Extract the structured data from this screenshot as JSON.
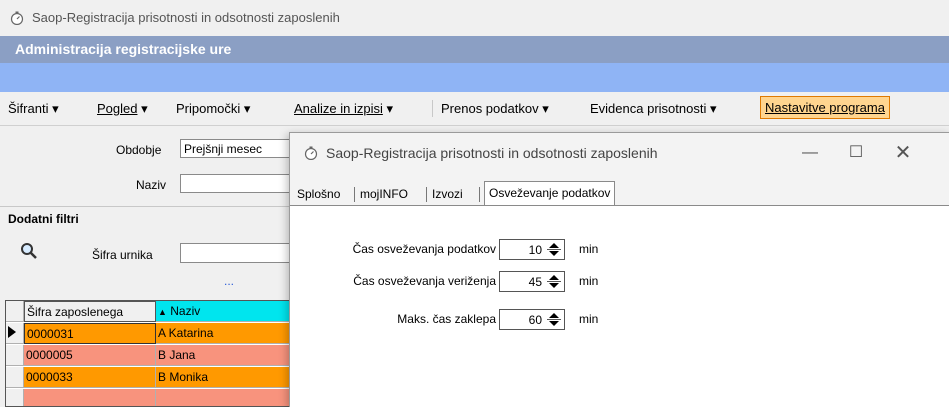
{
  "app": {
    "title": "Saop-Registracija prisotnosti in odsotnosti zaposlenih",
    "admin_title": "Administracija registracijske ure"
  },
  "menu": {
    "items": [
      {
        "label": "Šifranti",
        "arrow": "▾"
      },
      {
        "label": "Pogled",
        "arrow": "▾"
      },
      {
        "label": "Pripomočki",
        "arrow": "▾"
      },
      {
        "label": "Analize in izpisi",
        "arrow": "▾"
      },
      {
        "label": "Prenos podatkov",
        "arrow": "▾"
      },
      {
        "label": "Evidenca prisotnosti",
        "arrow": "▾"
      },
      {
        "label": "Nastavitve programa"
      }
    ]
  },
  "filters": {
    "period_label": "Obdobje",
    "period_value": "Prejšnji mesec",
    "name_label": "Naziv",
    "name_value": "",
    "extra_filters_title": "Dodatni filtri",
    "schedule_code_label": "Šifra urnika",
    "schedule_code_value": "",
    "ellipsis": "..."
  },
  "grid": {
    "columns": [
      {
        "label": "Šifra zaposlenega"
      },
      {
        "label": "Naziv",
        "sort": "▲"
      }
    ],
    "rows": [
      {
        "code": "0000031",
        "name": "A Katarina",
        "color": "#ff9900",
        "current": true
      },
      {
        "code": "0000005",
        "name": "B Jana",
        "color": "#f8937d"
      },
      {
        "code": "0000033",
        "name": "B Monika",
        "color": "#ff9900"
      },
      {
        "code": "",
        "name": "",
        "color": "#f8937d"
      }
    ],
    "header_sort_color": "#00e5ee"
  },
  "dialog": {
    "title": "Saop-Registracija prisotnosti in odsotnosti zaposlenih",
    "tabs": [
      "Splošno",
      "mojINFO",
      "Izvozi",
      "Osveževanje podatkov"
    ],
    "active_tab": "Osveževanje podatkov",
    "settings": [
      {
        "label": "Čas osveževanja podatkov",
        "value": "10",
        "unit": "min"
      },
      {
        "label": "Čas osveževanja veriženja",
        "value": "45",
        "unit": "min"
      },
      {
        "label": "Maks. čas zaklepa",
        "value": "60",
        "unit": "min"
      }
    ]
  },
  "colors": {
    "admin_bar": "#8b9fc4",
    "blue_band": "#8fb4f5",
    "highlight_menu_bg": "#ffd58f",
    "highlight_menu_border": "#e07a00"
  }
}
